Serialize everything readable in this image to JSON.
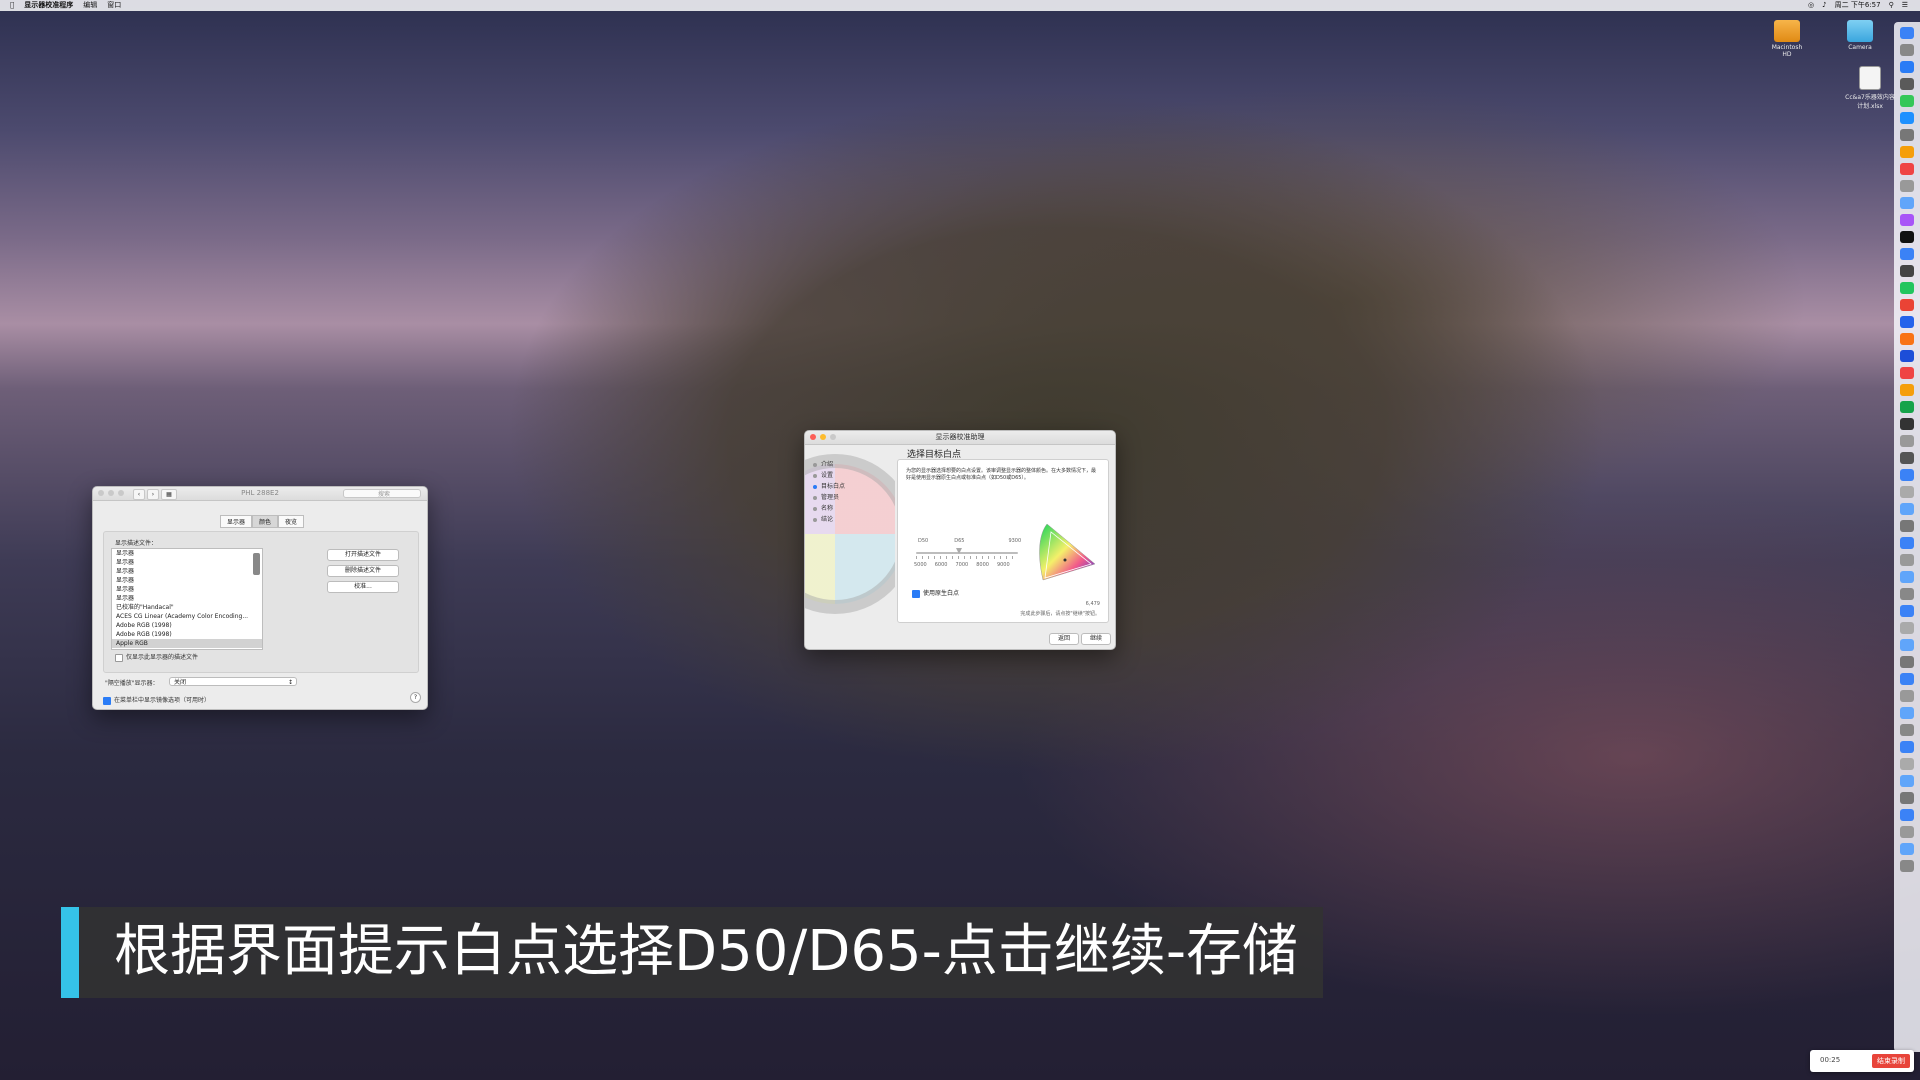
{
  "menubar": {
    "app_name": "显示器校准程序",
    "menu_edit": "编辑",
    "menu_window": "窗口",
    "clock": "周二 下午6:57"
  },
  "desktop": {
    "icon1_label": "Macintosh HD",
    "icon2_label": "Camera",
    "icon3_label": "Cc&a7乐器效内容计划.xlsx"
  },
  "display_window": {
    "title": "PHL 288E2",
    "search_placeholder": "搜索",
    "tabs": [
      "显示器",
      "颜色",
      "夜览"
    ],
    "selected_tab": "颜色",
    "profile_label": "显示描述文件：",
    "profiles": [
      "显示器",
      "显示器",
      "显示器",
      "显示器",
      "显示器",
      "显示器",
      "已校准的\"Handacal\"",
      "ACES CG Linear (Academy Color Encoding...",
      "Adobe RGB (1998)",
      "Adobe RGB (1998)",
      "Apple RGB"
    ],
    "selected_profile": "Apple RGB",
    "open_profile_button": "打开描述文件",
    "delete_profile_button": "删除描述文件",
    "calibrate_button": "校准...",
    "only_this_display": "仅显示此显示器的描述文件",
    "airplay_label": "\"隔空播放\"显示器：",
    "airplay_value": "关闭",
    "mirror_option": "在菜单栏中显示镜像选项（可用时）",
    "help": "?"
  },
  "assistant_window": {
    "title": "显示器校准助理",
    "steps": [
      "介绍",
      "设置",
      "目标白点",
      "管理员",
      "名称",
      "结论"
    ],
    "active_step": "目标白点",
    "heading": "选择目标白点",
    "description": "为您的显示器选择想要的白点设置。该审调整显示器的整体颜色。在大多数情况下，最好是使用显示器原生白点或标准白点（如D50或D65）。",
    "scale_top": [
      "D50",
      "D65",
      "9300"
    ],
    "scale_bottom": [
      "5000",
      "6000",
      "7000",
      "8000",
      "9000"
    ],
    "use_native_label": "使用原生白点",
    "use_native_checked": true,
    "value_readout": "6,479",
    "hint": "完成此步骤后，请点按\"继续\"按钮。",
    "back_button": "返回",
    "continue_button": "继续"
  },
  "subtitle": {
    "text": "根据界面提示白点选择D50/D65-点击继续-存储"
  },
  "recorder": {
    "time": "00:25",
    "stop_button": "结束录制"
  },
  "colors": {
    "accent": "#35c3e8",
    "selection_blue": "#2a7cf6",
    "recorder_red": "#e8443a"
  }
}
